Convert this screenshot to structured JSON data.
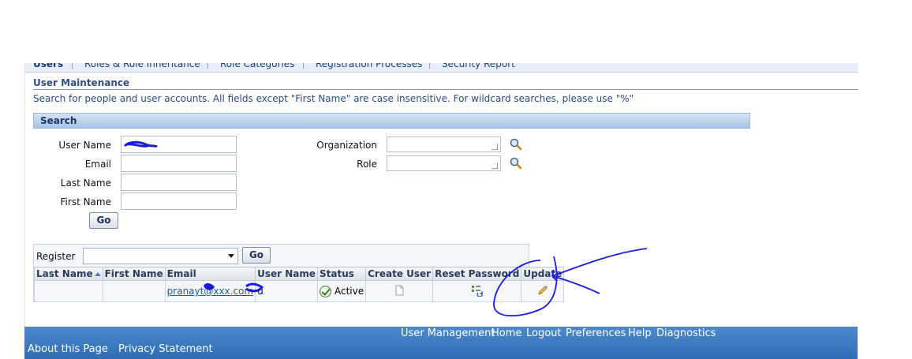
{
  "tabs": [
    "Users",
    "Roles & Role Inheritance",
    "Role Categories",
    "Registration Processes",
    "Security Report"
  ],
  "page": {
    "title": "User Maintenance",
    "instruction": "Search for people and user accounts. All fields except \"First Name\" are case insensitive. For wildcard searches, please use \"%\""
  },
  "search": {
    "header": "Search",
    "labels": {
      "user_name": "User Name",
      "email": "Email",
      "last_name": "Last Name",
      "first_name": "First Name",
      "organization": "Organization",
      "role": "Role"
    },
    "values": {
      "user_name": "",
      "email": "",
      "last_name": "",
      "first_name": ""
    },
    "go_label": "Go"
  },
  "results": {
    "register_label": "Register",
    "register_value": "",
    "go_label": "Go",
    "columns": [
      "Last Name",
      "First Name",
      "Email",
      "User Name",
      "Status",
      "Create User",
      "Reset Password",
      "Update"
    ],
    "rows": [
      {
        "last_name": "",
        "first_name": "",
        "email": "pranayt@xxx.com",
        "user_name": "u",
        "status": "Active"
      }
    ]
  },
  "footer": {
    "links": [
      "User Management",
      "Home",
      "Logout",
      "Preferences",
      "Help",
      "Diagnostics"
    ],
    "bottom_links": [
      "About this Page",
      "Privacy Statement"
    ]
  },
  "icons": {
    "search": "magnifier-icon",
    "create_user": "document-icon",
    "reset_password": "reset-password-icon",
    "update": "pencil-icon",
    "status": "checkmark-icon"
  },
  "colors": {
    "link": "#1a5d8f",
    "footer": "#2f6db6",
    "annotation": "#1b1be0"
  }
}
